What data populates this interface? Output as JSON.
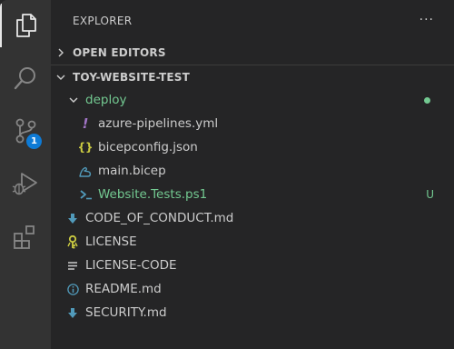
{
  "sidebar": {
    "title": "EXPLORER",
    "more_label": "···",
    "open_editors": "OPEN EDITORS",
    "project": "TOY-WEBSITE-TEST",
    "folder": "deploy",
    "folder_status": "modified-dot",
    "files": {
      "azure_pipelines": "azure-pipelines.yml",
      "bicepconfig": "bicepconfig.json",
      "main_bicep": "main.bicep",
      "website_tests": "Website.Tests.ps1",
      "website_tests_status": "U",
      "code_of_conduct": "CODE_OF_CONDUCT.md",
      "license": "LICENSE",
      "license_code": "LICENSE-CODE",
      "readme": "README.md",
      "security": "SECURITY.md"
    }
  },
  "activity_bar": {
    "items": [
      "files-icon",
      "search-icon",
      "source-control-icon",
      "run-debug-icon",
      "extensions-icon"
    ],
    "source_control_badge": "1"
  },
  "colors": {
    "accent": "#0e7bd6",
    "untracked": "#73c991",
    "sidebar_bg": "#252526",
    "activity_bg": "#333333"
  }
}
